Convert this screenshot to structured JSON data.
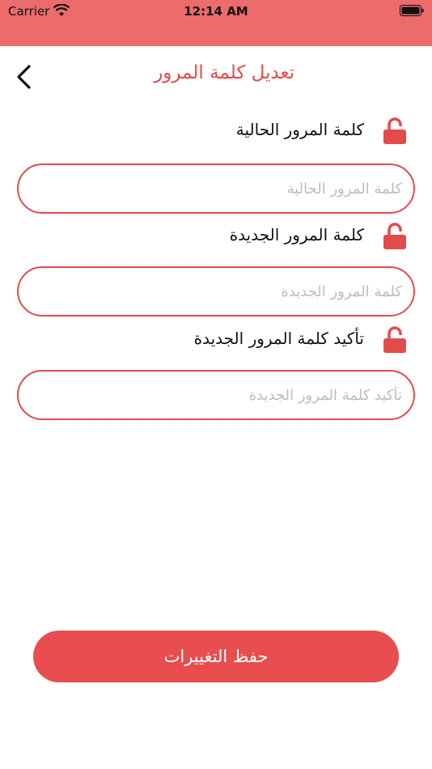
{
  "status_bar": {
    "carrier": "Carrier",
    "time": "12:14 AM"
  },
  "nav": {
    "title": "تعديل كلمة المرور"
  },
  "fields": [
    {
      "label": "كلمة المرور الحالية",
      "placeholder": "كلمة المرور الحالية"
    },
    {
      "label": "كلمة المرور الجديدة",
      "placeholder": "كلمة المرور الجديدة"
    },
    {
      "label": "تأكيد كلمة المرور الجديدة",
      "placeholder": "تأكيد كلمة المرور الجديدة"
    }
  ],
  "save_label": "حفظ التغييرات",
  "colors": {
    "accent": "#e34b4b",
    "status_bar": "#ec6b6b",
    "button": "#e84d4f"
  },
  "icons": {
    "field_icon": "lock-icon",
    "back": "chevron-left-icon"
  }
}
